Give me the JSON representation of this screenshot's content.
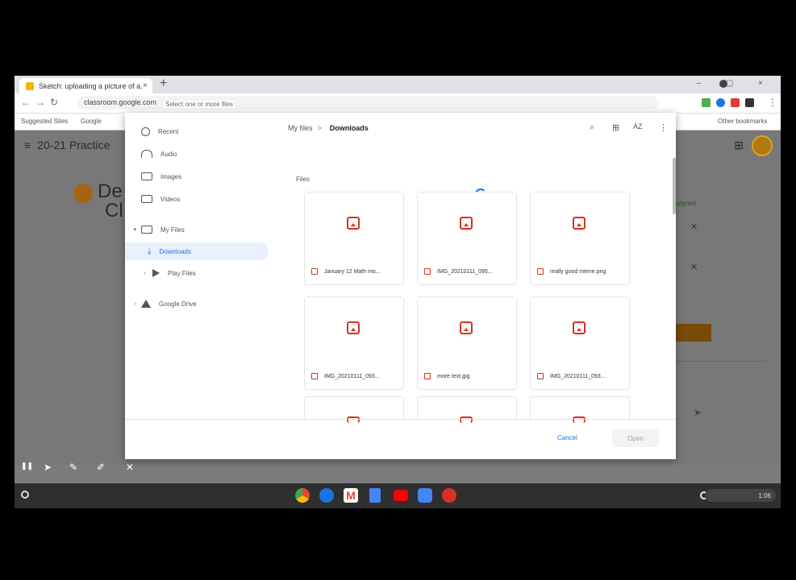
{
  "browser": {
    "tab_title": "Sketch: uploading a picture of a...",
    "tab_close": "×",
    "new_tab": "+",
    "address": "classroom.google.com",
    "window_controls": "– ▢ ×",
    "bookmarks": [
      {
        "label": "Suggested Sites"
      },
      {
        "label": "Google"
      }
    ],
    "other_bookmarks": "Other bookmarks"
  },
  "page": {
    "course_title": "20-21 Practice",
    "menu_icon": "≡",
    "apps_icon": "⊞",
    "heading_1": "De",
    "heading_2": "Cl",
    "assigned_label": "Assigned",
    "close_1": "✕",
    "close_2": "✕",
    "send_icon": "➤"
  },
  "dialog": {
    "title": "Select one or more files",
    "sidebar": [
      {
        "label": "Recent",
        "icon": "clock-icon"
      },
      {
        "label": "Audio",
        "icon": "headphones-icon"
      },
      {
        "label": "Images",
        "icon": "image-icon"
      },
      {
        "label": "Videos",
        "icon": "video-icon"
      },
      {
        "label": "My Files",
        "icon": "laptop-icon"
      },
      {
        "label": "Downloads",
        "icon": "download-icon"
      },
      {
        "label": "Play Files",
        "icon": "play-icon"
      },
      {
        "label": "Google Drive",
        "icon": "drive-icon"
      }
    ],
    "breadcrumb": {
      "root": "My files",
      "separator": ">",
      "current": "Downloads"
    },
    "header_icons": {
      "search": "⌕",
      "grid": "⊞",
      "sort": "AZ",
      "more": "⋮"
    },
    "section_label": "Files",
    "files": [
      {
        "name": "January 12 Math mo..."
      },
      {
        "name": "IMG_20210111_095..."
      },
      {
        "name": "really good meme.png"
      },
      {
        "name": "IMG_20210111_093..."
      },
      {
        "name": "more text.jpg"
      },
      {
        "name": "IMG_20210111_093..."
      }
    ],
    "cancel_label": "Cancel",
    "open_label": "Open"
  },
  "annotation_tools": {
    "pause": "❚❚",
    "pointer": "➤",
    "pen": "✎",
    "marker": "✐",
    "close": "✕"
  },
  "shelf": {
    "apps": [
      {
        "name": "chrome-app",
        "color": "#e8453c"
      },
      {
        "name": "play-store-app",
        "color": "#1a73e8"
      },
      {
        "name": "gmail-app",
        "color": "#ea4335"
      },
      {
        "name": "docs-app",
        "color": "#4285f4"
      },
      {
        "name": "youtube-app",
        "color": "#ff0000"
      },
      {
        "name": "camera-app",
        "color": "#4285f4"
      },
      {
        "name": "screencast-app",
        "color": "#d93025"
      }
    ],
    "clock": "1:06"
  }
}
